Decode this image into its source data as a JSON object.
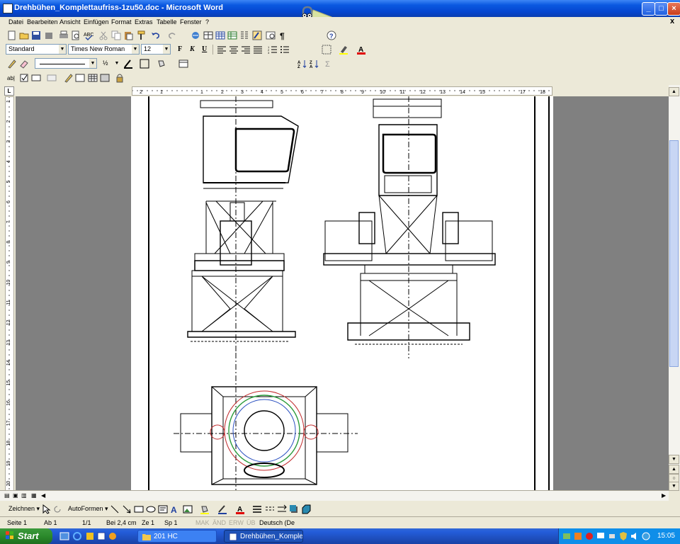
{
  "window": {
    "title": "Drehbühen_Komplettaufriss-1zu50.doc - Microsoft Word",
    "close_doc": "x"
  },
  "menu": [
    "Datei",
    "Bearbeiten",
    "Ansicht",
    "Einfügen",
    "Format",
    "Extras",
    "Tabelle",
    "Fenster",
    "?"
  ],
  "formatting": {
    "style": "Standard",
    "font": "Times New Roman",
    "size": "12",
    "bold": "F",
    "italic": "K",
    "underline": "U"
  },
  "lines": {
    "weight": "½"
  },
  "ruler": {
    "corner": "L",
    "h_labels": [
      "2",
      "1",
      "1",
      "2",
      "3",
      "4",
      "5",
      "6",
      "7",
      "8",
      "9",
      "10",
      "11",
      "12",
      "13",
      "14",
      "15",
      "17",
      "18"
    ],
    "v_labels": [
      "1",
      "2",
      "3",
      "4",
      "5",
      "6",
      "7",
      "8",
      "9",
      "10",
      "11",
      "12",
      "13",
      "14",
      "15",
      "16",
      "17",
      "18",
      "19",
      "20"
    ]
  },
  "drawing_toolbar": {
    "draw": "Zeichnen ▾",
    "autoshapes": "AutoFormen ▾"
  },
  "status": {
    "page": "Seite 1",
    "section": "Ab 1",
    "pages": "1/1",
    "at": "Bei 2,4 cm",
    "line": "Ze 1",
    "col": "Sp 1",
    "mak": "MAK",
    "and": "ÄND",
    "erw": "ERW",
    "ub": "ÜB",
    "language": "Deutsch (De"
  },
  "taskbar": {
    "start": "Start",
    "tasks": [
      {
        "label": "201 HC"
      },
      {
        "label": "Drehbühen_Komplett..."
      }
    ],
    "clock": "15:05"
  },
  "colors": {
    "titlebar": "#0a58e0",
    "taskbar": "#245edb",
    "start": "#2b8a2b",
    "tray": "#0f8ee9",
    "drawing_green": "#2a9a3a",
    "drawing_red": "#c0282a",
    "drawing_blue": "#2a50c0"
  }
}
